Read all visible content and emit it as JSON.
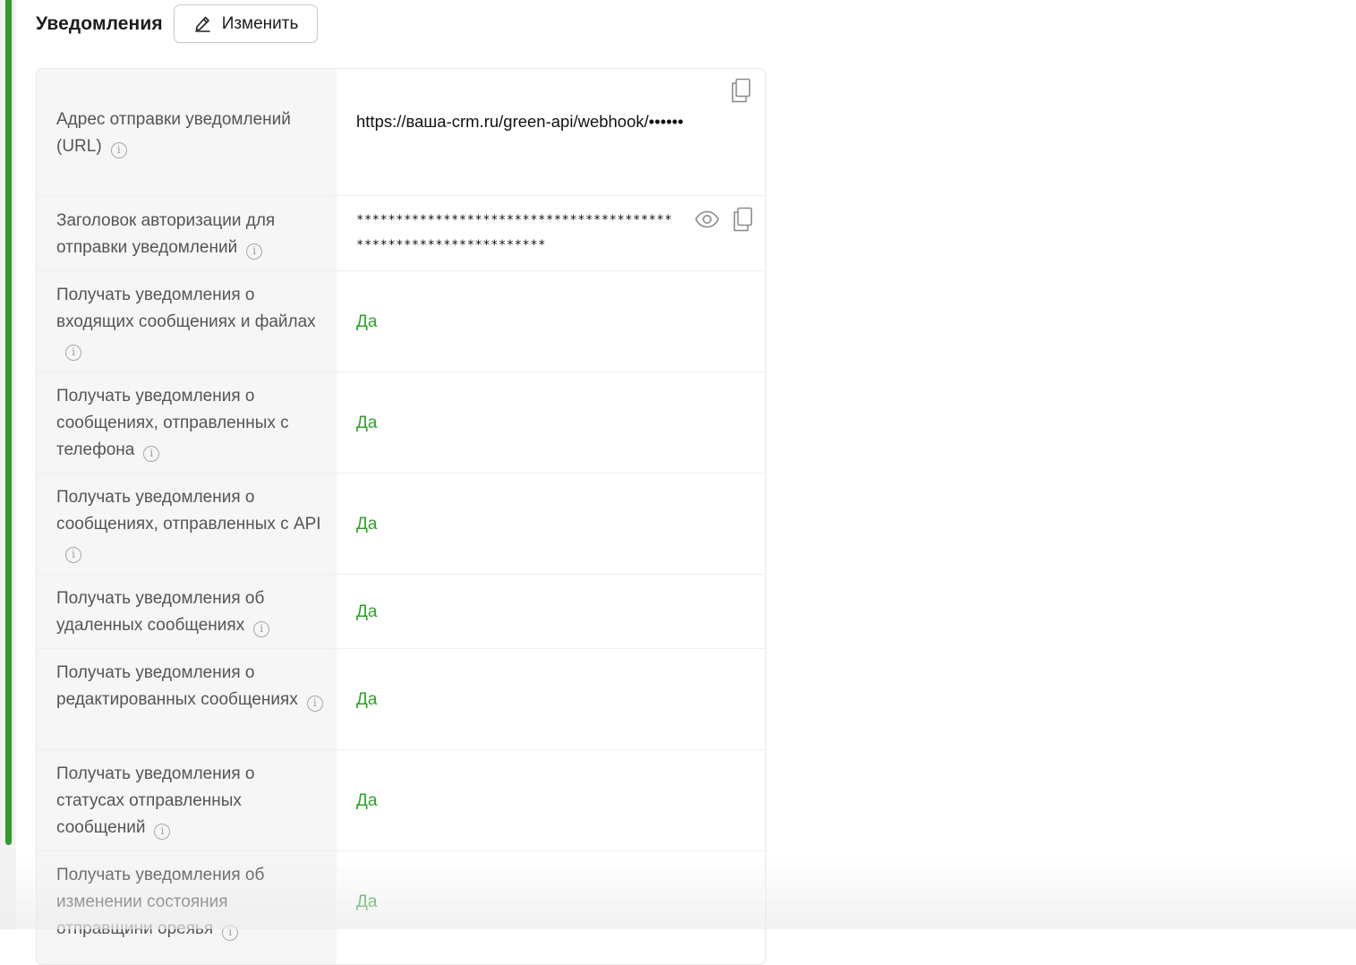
{
  "header": {
    "title": "Уведомления",
    "edit_label": "Изменить"
  },
  "rows": [
    {
      "label": "Адрес отправки уведомлений (URL)",
      "value": "https://ваша-crm.ru/green-api/webhook/••••••"
    },
    {
      "label": "Заголовок авторизации для отправки уведомлений",
      "value_line1": "****************************************",
      "value_line2": "************************"
    },
    {
      "label": "Получать уведомления о входящих сообщениях и файлах",
      "value": "Да"
    },
    {
      "label": "Получать уведомления о сообщениях, отправленных с телефона",
      "value": "Да"
    },
    {
      "label": "Получать уведомления о сообщениях, отправленных с API",
      "value": "Да"
    },
    {
      "label": "Получать уведомления об удаленных сообщениях",
      "value": "Да"
    },
    {
      "label": "Получать уведомления о редактированных сообщениях",
      "value": "Да"
    },
    {
      "label": "Получать уведомления о статусах отправленных сообщений",
      "value": "Да"
    },
    {
      "label": "Получать уведомления об изменении состояния отправщини ореяья",
      "value": "Да"
    }
  ],
  "icons": {
    "edit": "pencil-icon",
    "copy": "copy-icon",
    "show": "eye-icon",
    "info": "info-icon"
  },
  "colors": {
    "accent": "#2e9e2a",
    "yes_text": "#2fa12a",
    "label_text": "#555555"
  }
}
